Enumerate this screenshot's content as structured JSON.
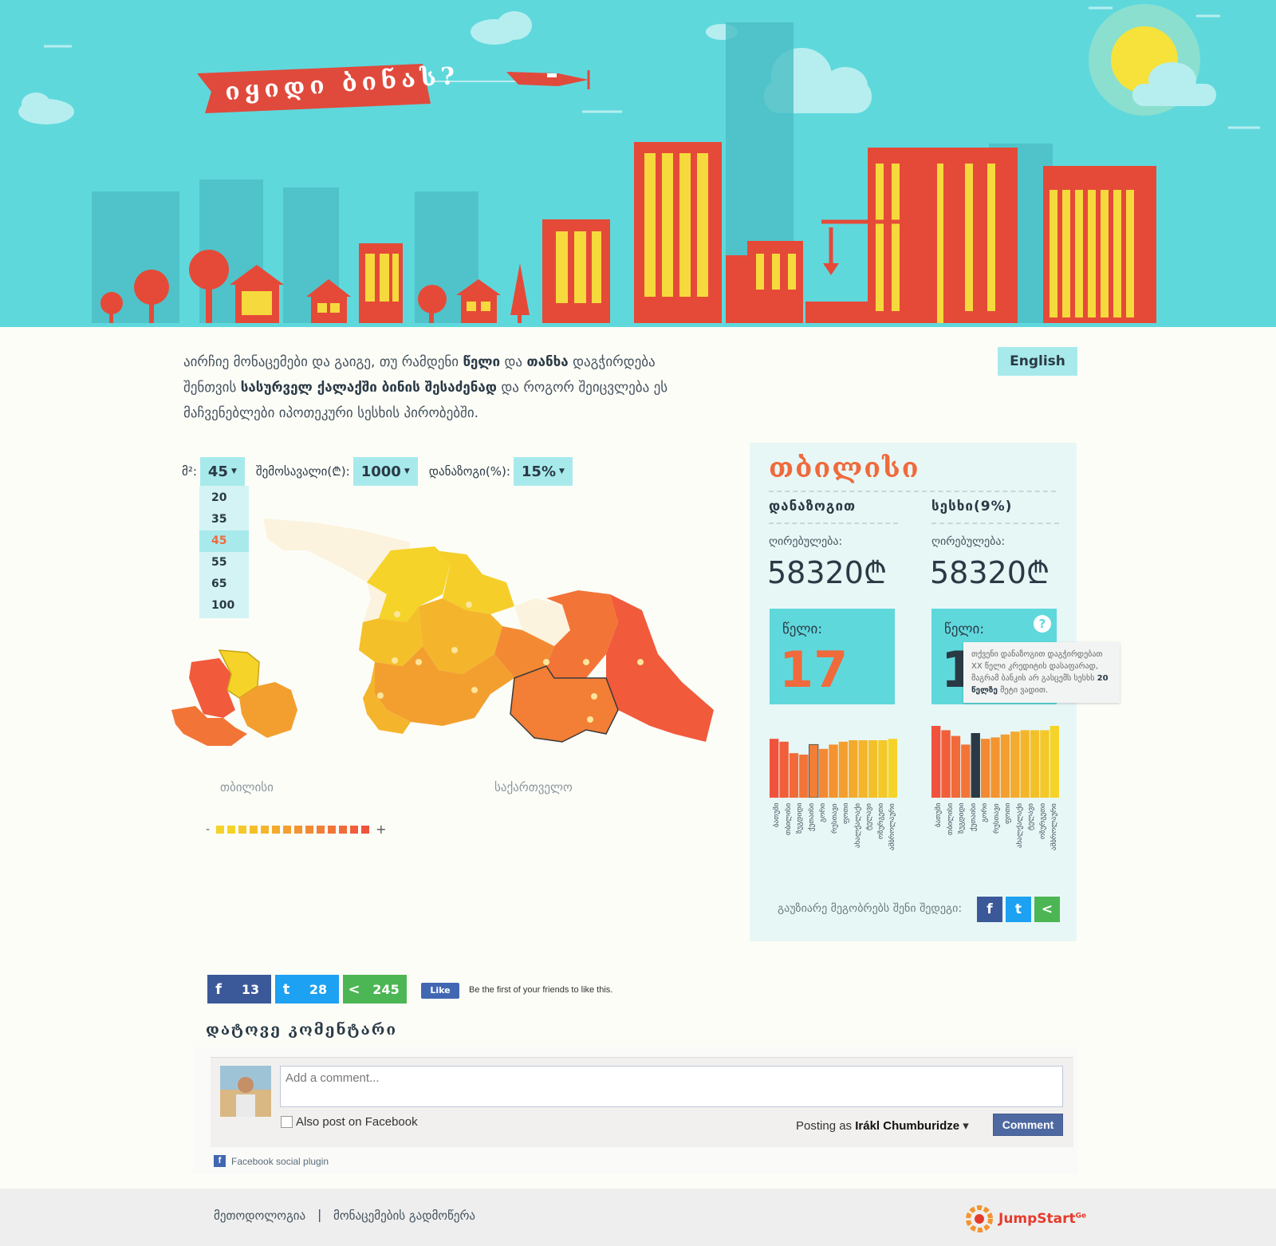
{
  "hero": {
    "banner_text": "იყიდი ბინას?"
  },
  "intro": {
    "part1": "აირჩიე მონაცემები და გაიგე, თუ რამდენი ",
    "bold1": "წელი",
    "part2": " და ",
    "bold2": "თანხა",
    "part3": " დაგჭირდება შენთვის ",
    "bold3": "სასურველ ქალაქში ბინის შესაძენად",
    "part4": " და როგორ შეიცვლება ეს მაჩვენებლები იპოთეკური სესხის პირობებში."
  },
  "language_button": "English",
  "controls": {
    "area_label": "მ²:",
    "area_value": "45",
    "income_label": "შემოსავალი(₾):",
    "income_value": "1000",
    "savings_label": "დანაზოგი(%):",
    "savings_value": "15%",
    "area_options": [
      "20",
      "35",
      "45",
      "55",
      "65",
      "100"
    ],
    "area_selected": "45"
  },
  "map": {
    "tbilisi_label": "თბილისი",
    "georgia_label": "საქართველო",
    "legend_minus": "-",
    "legend_plus": "+",
    "legend_colors": [
      "#f5d328",
      "#f5d328",
      "#f4c829",
      "#f4c02a",
      "#f4b52c",
      "#f3aa2d",
      "#f39f2f",
      "#f39430",
      "#f38a33",
      "#f27f35",
      "#f27537",
      "#f16a39",
      "#f15e3a",
      "#f0533c"
    ]
  },
  "panel": {
    "city": "თბილისი",
    "col1_title": "დანაზოგით",
    "col2_title": "სესხი(9%)",
    "value_label": "ღირებულება:",
    "col1_value": "58320₾",
    "col2_value": "58320₾",
    "years_label": "წელი:",
    "col1_years": "17",
    "col2_years": "1",
    "help_icon": "?",
    "tooltip_text": "თქვენი დანაზოგით დაგჭირდებათ XX წელი კრედიტის დასაფარად, მაგრამ ბანკის არ გასცემს სესხს ",
    "tooltip_bold": "20 წელზე",
    "tooltip_end": " მეტი ვადით.",
    "bar_labels": [
      "ბათუმი",
      "თბილისი",
      "ზუგდიდი",
      "ქუთაისი",
      "გორი",
      "რუსთავი",
      "ფოთი",
      "ახალქალაქი",
      "ტელავი",
      "ოზურგეთი",
      "ამბროლაური"
    ],
    "col1_bar_values": [
      0.82,
      0.78,
      0.62,
      0.6,
      0.74,
      0.68,
      0.74,
      0.78,
      0.8,
      0.8,
      0.8,
      0.8,
      0.82
    ],
    "col1_highlight_index": 4,
    "col2_bar_values": [
      1.0,
      0.94,
      0.86,
      0.74,
      0.9,
      0.82,
      0.84,
      0.88,
      0.92,
      0.94,
      0.94,
      0.94,
      1.0
    ],
    "col2_highlight_index": 4,
    "share_text": "გაუზიარე მეგობრებს შენი შედეგი:"
  },
  "social": {
    "facebook_count": "13",
    "twitter_count": "28",
    "share_count": "245",
    "like_label": "Like",
    "like_text": "Be the first of your friends to like this."
  },
  "comments": {
    "title": "დატოვე კომენტარი",
    "placeholder": "Add a comment...",
    "also_post": "Also post on Facebook",
    "posting_as": "Posting as ",
    "user_name": "Irákl Chumburidze",
    "button": "Comment",
    "plugin_label": "Facebook social plugin"
  },
  "footer": {
    "link1": "მეთოდოლოგია",
    "separator": "|",
    "link2": "მონაცემების გადმოწერა",
    "logo_text": "JumpStart",
    "logo_sup": "Ge"
  },
  "colors": {
    "accent": "#5fd8dc",
    "orange": "#f06a3c",
    "panel_bg": "#e7f7f6",
    "facebook": "#3b5998",
    "twitter": "#1da1f2",
    "share": "#4cb654"
  }
}
